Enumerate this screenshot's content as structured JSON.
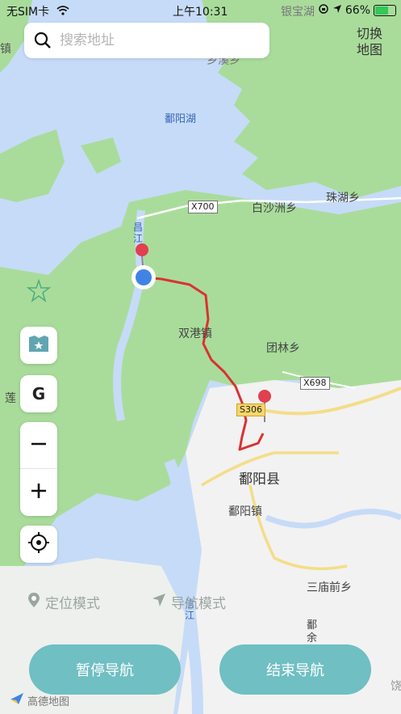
{
  "status_bar": {
    "carrier": "无SIM卡",
    "time": "上午10:31",
    "battery": "66%"
  },
  "search": {
    "placeholder": "搜索地址"
  },
  "switch_map": {
    "line1": "切换",
    "line2": "地图"
  },
  "controls": {
    "g_label": "G"
  },
  "map_labels": {
    "poyang_lake": "鄱阳湖",
    "yinbao_lake": "银宝湖",
    "xiangxiang": "乡溪乡",
    "baishazhou": "白沙洲乡",
    "zhuhu": "珠湖乡",
    "shuanggang": "双港镇",
    "tuanlin": "团林乡",
    "poyang_county": "鄱阳县",
    "poyang_town": "鄱阳镇",
    "sanmiaoqian": "三庙前乡",
    "lian": "莲",
    "changjiang": "昌江",
    "xinjiang": "信江",
    "poyu": "鄱余",
    "rao": "饶",
    "zhen": "镇"
  },
  "road_labels": {
    "x700": "X700",
    "x698": "X698",
    "s306": "S306"
  },
  "modes": {
    "locate": "定位模式",
    "navigate": "导航模式"
  },
  "buttons": {
    "pause": "暂停导航",
    "end": "结束导航"
  },
  "attribution": "高德地图",
  "colors": {
    "water": "#c6dbf7",
    "land": "#a9dc9b",
    "urban": "#f2f2f2",
    "route": "#d93232",
    "button": "#6fbfc3",
    "marker": "#e0404f",
    "location": "#3f84e5"
  }
}
